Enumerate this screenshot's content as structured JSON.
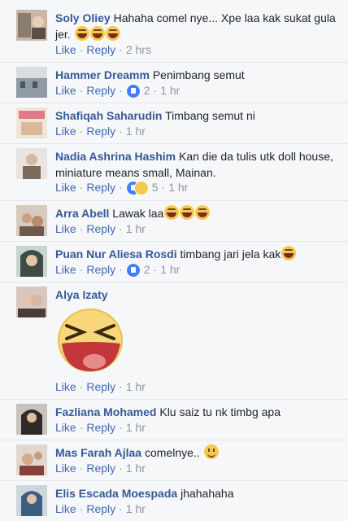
{
  "colors": {
    "link": "#365899",
    "action": "#4267b2",
    "meta": "#90949c",
    "text": "#1d2129",
    "background": "#f6f7f9"
  },
  "comments": [
    {
      "name": "Soly Oliey",
      "text": "Hahaha comel nye... Xpe laa kak sukat gula jer.",
      "emoji_count": 3,
      "emoji": "laugh-emoji",
      "like": "Like",
      "reply": "Reply",
      "time": "2 hrs"
    },
    {
      "name": "Hammer Dreamm",
      "text": "Penimbang semut",
      "like": "Like",
      "reply": "Reply",
      "reactions": "2",
      "time": "1 hr"
    },
    {
      "name": "Shafiqah Saharudin",
      "text": "Timbang semut ni",
      "like": "Like",
      "reply": "Reply",
      "time": "1 hr"
    },
    {
      "name": "Nadia Ashrina Hashim",
      "text": "Kan die da tulis utk doll house, miniature means small, Mainan.",
      "like": "Like",
      "reply": "Reply",
      "reactions": "5",
      "time": "1 hr"
    },
    {
      "name": "Arra Abell",
      "text": "Lawak laa",
      "emoji_count": 3,
      "emoji": "laugh-emoji",
      "like": "Like",
      "reply": "Reply",
      "time": "1 hr"
    },
    {
      "name": "Puan Nur Aliesa Rosdi",
      "text": "timbang jari jela kak",
      "emoji_count": 1,
      "emoji": "laugh-emoji",
      "like": "Like",
      "reply": "Reply",
      "reactions": "2",
      "time": "1 hr"
    },
    {
      "name": "Alya Izaty",
      "text": "",
      "sticker": "laughing-face-sticker",
      "like": "Like",
      "reply": "Reply",
      "time": "1 hr"
    },
    {
      "name": "Fazliana Mohamed",
      "text": "Klu saiz tu nk timbg apa",
      "like": "Like",
      "reply": "Reply",
      "time": "1 hr"
    },
    {
      "name": "Mas Farah Ajlaa",
      "text": "comelnye..",
      "emoji_count": 1,
      "emoji": "smile-emoji",
      "like": "Like",
      "reply": "Reply",
      "time": "1 hr"
    },
    {
      "name": "Elis Escada Moespada",
      "text": "jhahahaha",
      "like": "Like",
      "reply": "Reply",
      "time": "1 hr"
    }
  ]
}
